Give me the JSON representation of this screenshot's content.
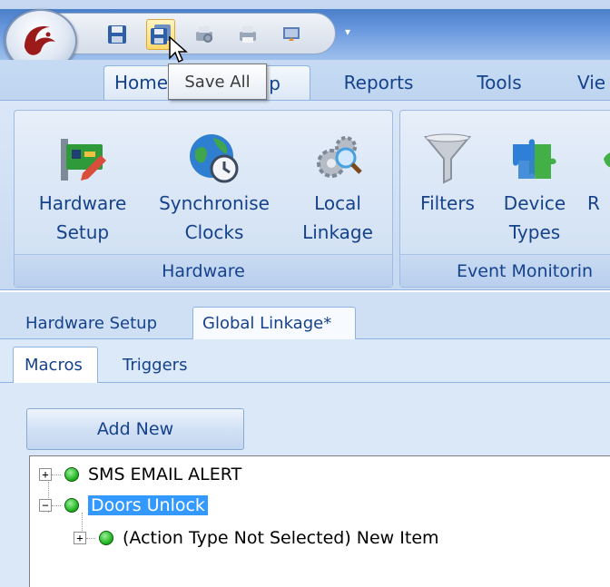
{
  "ribbon": {
    "tabs": [
      {
        "label": "Home"
      },
      {
        "label": "Setup"
      },
      {
        "label": "Reports"
      },
      {
        "label": "Tools"
      },
      {
        "label": "Vie"
      }
    ],
    "active_tab_visible_suffix": "p",
    "groups": [
      {
        "label": "Hardware",
        "buttons": [
          {
            "line1": "Hardware",
            "line2": "Setup",
            "icon": "hardware-card-icon"
          },
          {
            "line1": "Synchronise",
            "line2": "Clocks",
            "icon": "globe-clock-icon"
          },
          {
            "line1": "Local",
            "line2": "Linkage",
            "icon": "gears-magnifier-icon"
          }
        ]
      },
      {
        "label": "Event Monitorin",
        "buttons": [
          {
            "line1": "Filters",
            "line2": "",
            "icon": "funnel-icon"
          },
          {
            "line1": "Device",
            "line2": "Types",
            "icon": "puzzle-icon"
          },
          {
            "line1": "R",
            "line2": "",
            "icon": "partial-icon"
          }
        ]
      }
    ]
  },
  "quick_access": {
    "icons": [
      "save-icon",
      "save-all-icon",
      "print-preview-icon",
      "print-icon",
      "screen-export-icon",
      "customize-dropdown-icon"
    ],
    "tooltip": "Save All"
  },
  "document_tabs": [
    {
      "label": "Hardware Setup"
    },
    {
      "label": "Global Linkage*"
    }
  ],
  "sub_tabs": [
    {
      "label": "Macros"
    },
    {
      "label": "Triggers"
    }
  ],
  "content": {
    "add_new_label": "Add New",
    "tree": [
      {
        "label": "SMS EMAIL ALERT",
        "expander": "+",
        "status_color": "#1fb21f"
      },
      {
        "label": "Doors Unlock",
        "expander": "−",
        "status_color": "#1fb21f",
        "selected": true
      },
      {
        "label": "(Action Type Not Selected) New Item",
        "expander": "+",
        "status_color": "#1fb21f",
        "child": true
      }
    ]
  },
  "colors": {
    "ribbon_text": "#15428b",
    "selection": "#3399ff"
  }
}
